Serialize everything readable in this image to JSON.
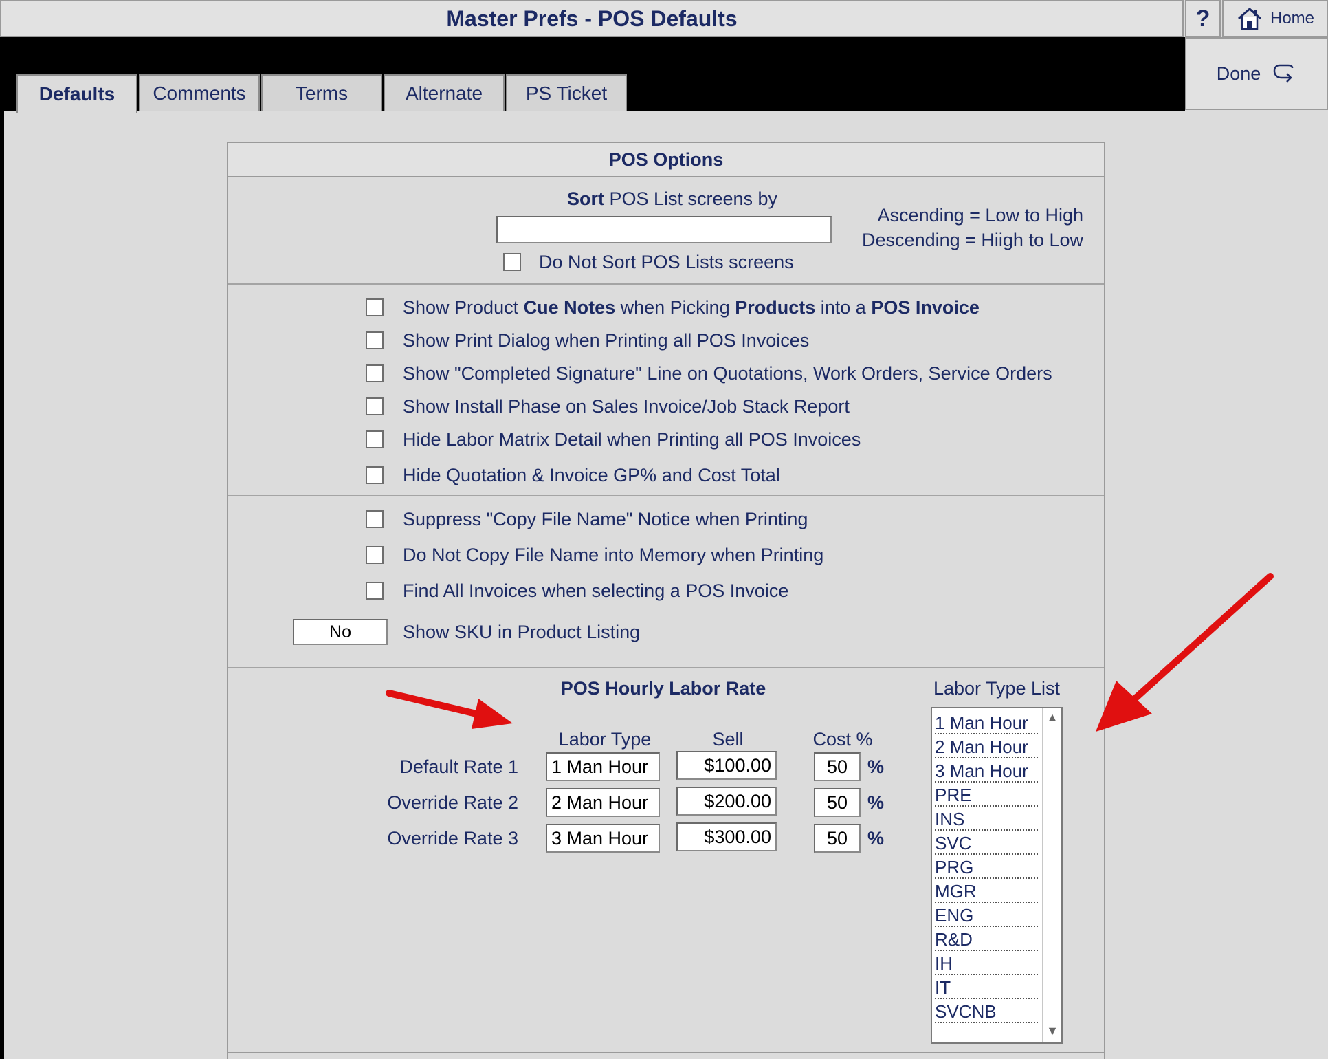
{
  "window": {
    "title": "Master Prefs - POS Defaults"
  },
  "nav": {
    "help_label": "?",
    "home_label": "Home",
    "done_label": "Done"
  },
  "tabs": [
    {
      "label": "Defaults",
      "active": true
    },
    {
      "label": "Comments",
      "active": false
    },
    {
      "label": "Terms",
      "active": false
    },
    {
      "label": "Alternate",
      "active": false
    },
    {
      "label": "PS Ticket",
      "active": false
    }
  ],
  "panel": {
    "title": "POS Options",
    "sort": {
      "heading_bold": "Sort",
      "heading_rest": " POS List screens by",
      "value": "",
      "ascending_note": "Ascending = Low to High",
      "descending_note": "Descending = Hiigh to Low",
      "no_sort_label": "Do Not Sort POS Lists screens",
      "no_sort_checked": false
    },
    "display_options": [
      {
        "label": "Show Product Cue Notes when Picking Products into a POS Invoice",
        "checked": false
      },
      {
        "label": "Show Print Dialog when Printing all POS Invoices",
        "checked": false
      },
      {
        "label": "Show \"Completed Signature\" Line on Quotations, Work Orders, Service Orders",
        "checked": false
      },
      {
        "label": "Show Install Phase on Sales Invoice/Job Stack Report",
        "checked": false
      },
      {
        "label": "Hide Labor Matrix Detail when Printing all POS Invoices",
        "checked": false
      },
      {
        "label": "Hide Quotation & Invoice GP%  and Cost Total",
        "checked": false
      }
    ],
    "cue_notes_parts": [
      "Show Product ",
      "Cue Notes",
      " when Picking ",
      "Products",
      " into a ",
      "POS Invoice"
    ],
    "print_options": [
      {
        "label": "Suppress \"Copy File Name\" Notice when Printing",
        "checked": false
      },
      {
        "label": "Do Not Copy File Name into Memory when Printing",
        "checked": false
      },
      {
        "label": "Find All Invoices when selecting a POS Invoice",
        "checked": false
      }
    ],
    "sku": {
      "value": "No",
      "label": "Show SKU in Product Listing"
    },
    "labor": {
      "title": "POS Hourly Labor Rate",
      "col_type": "Labor Type",
      "col_sell": "Sell",
      "col_cost": "Cost %",
      "percent_sign": "%",
      "rows": [
        {
          "label": "Default Rate 1",
          "type": "1 Man Hour",
          "sell": "$100.00",
          "cost": "50"
        },
        {
          "label": "Override Rate 2",
          "type": "2 Man Hour",
          "sell": "$200.00",
          "cost": "50"
        },
        {
          "label": "Override Rate 3",
          "type": "3 Man Hour",
          "sell": "$300.00",
          "cost": "50"
        }
      ],
      "list_title": "Labor Type List",
      "list_items": [
        "1 Man Hour",
        "2 Man Hour",
        "3 Man Hour",
        "PRE",
        "INS",
        "SVC",
        "PRG",
        "MGR",
        "ENG",
        "R&D",
        "IH",
        "IT",
        "SVCNB"
      ]
    }
  },
  "colors": {
    "text": "#1c2a64",
    "arrow": "#e01010",
    "background": "#dcdcdc"
  }
}
